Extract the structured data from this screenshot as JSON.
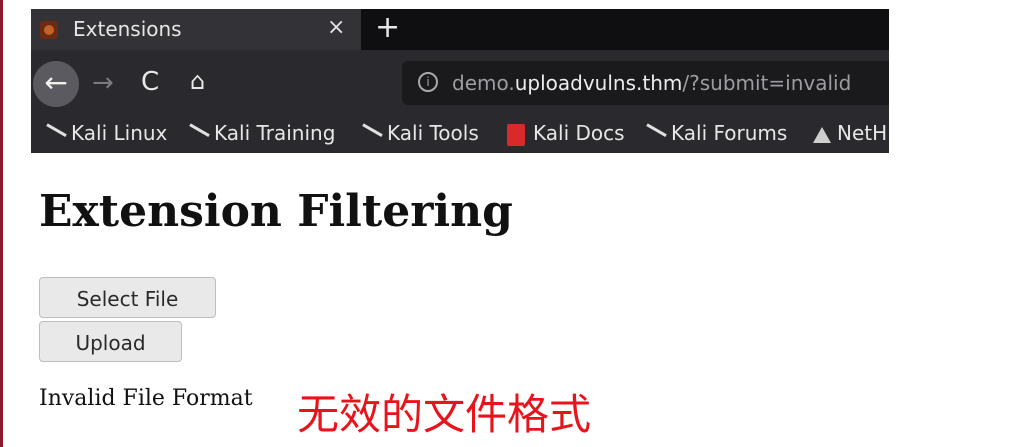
{
  "browser": {
    "tab": {
      "title": "Extensions",
      "close_label": "×",
      "favicon": "kali-favicon"
    },
    "new_tab_label": "+",
    "nav": {
      "back": "←",
      "forward": "→",
      "reload": "C",
      "home": "⌂"
    },
    "url": {
      "prefix": "demo.",
      "domain": "uploadvulns.thm",
      "path": "/?submit=invalid"
    },
    "bookmarks": [
      {
        "label": "Kali Linux",
        "icon": "kali-dragon-icon"
      },
      {
        "label": "Kali Training",
        "icon": "kali-dragon-icon"
      },
      {
        "label": "Kali Tools",
        "icon": "kali-dragon-icon"
      },
      {
        "label": "Kali Docs",
        "icon": "kali-docs-icon"
      },
      {
        "label": "Kali Forums",
        "icon": "kali-dragon-icon"
      },
      {
        "label": "NetH",
        "icon": "nethunter-icon"
      }
    ]
  },
  "page": {
    "heading": "Extension Filtering",
    "select_file_label": "Select File",
    "upload_label": "Upload",
    "status_text": "Invalid File Format"
  },
  "annotation": {
    "text": "无效的文件格式",
    "color": "#e8141b"
  },
  "colors": {
    "accent_border": "#8b1a2e"
  }
}
